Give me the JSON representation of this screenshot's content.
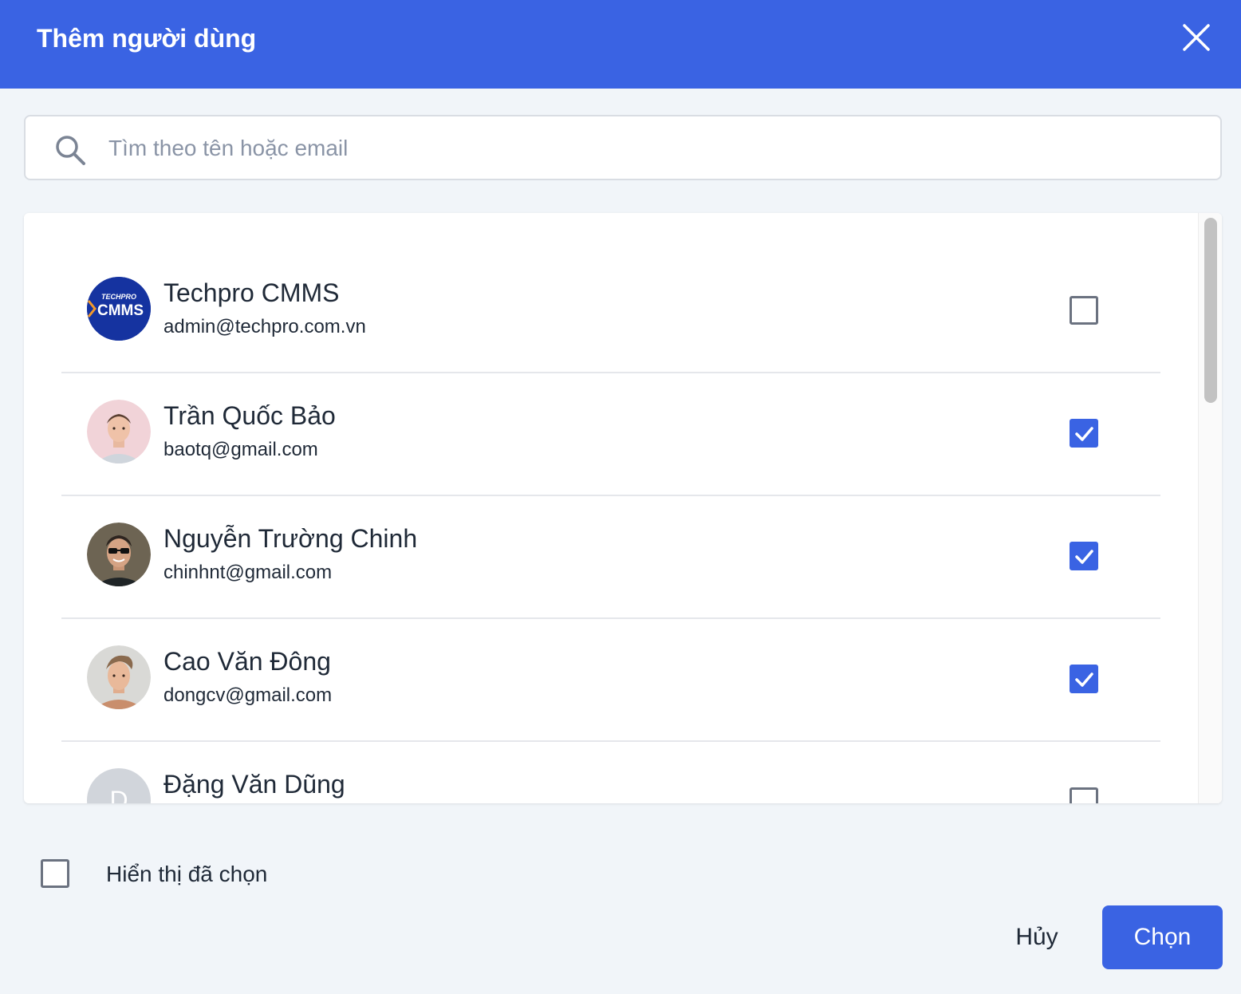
{
  "dialog": {
    "title": "Thêm người dùng",
    "close_icon": "close-icon"
  },
  "search": {
    "icon": "search-icon",
    "placeholder": "Tìm theo tên hoặc email",
    "value": ""
  },
  "users": [
    {
      "name": "Techpro CMMS",
      "email": "admin@techpro.com.vn",
      "checked": false,
      "avatar": "techpro-logo",
      "logo_top": "TECHPRO",
      "logo_main": "CMMS"
    },
    {
      "name": "Trần Quốc Bảo",
      "email": "baotq@gmail.com",
      "checked": true,
      "avatar": "photo"
    },
    {
      "name": "Nguyễn Trường Chinh",
      "email": "chinhnt@gmail.com",
      "checked": true,
      "avatar": "photo"
    },
    {
      "name": "Cao Văn Đông",
      "email": "dongcv@gmail.com",
      "checked": true,
      "avatar": "photo"
    },
    {
      "name": "Đặng Văn Dũng",
      "email": "",
      "checked": false,
      "avatar": "initial",
      "initial": "D"
    }
  ],
  "footer": {
    "show_selected_label": "Hiển thị đã chọn",
    "show_selected_checked": false,
    "cancel_label": "Hủy",
    "confirm_label": "Chọn"
  },
  "colors": {
    "accent": "#3a63e3",
    "background": "#f1f5f9"
  }
}
